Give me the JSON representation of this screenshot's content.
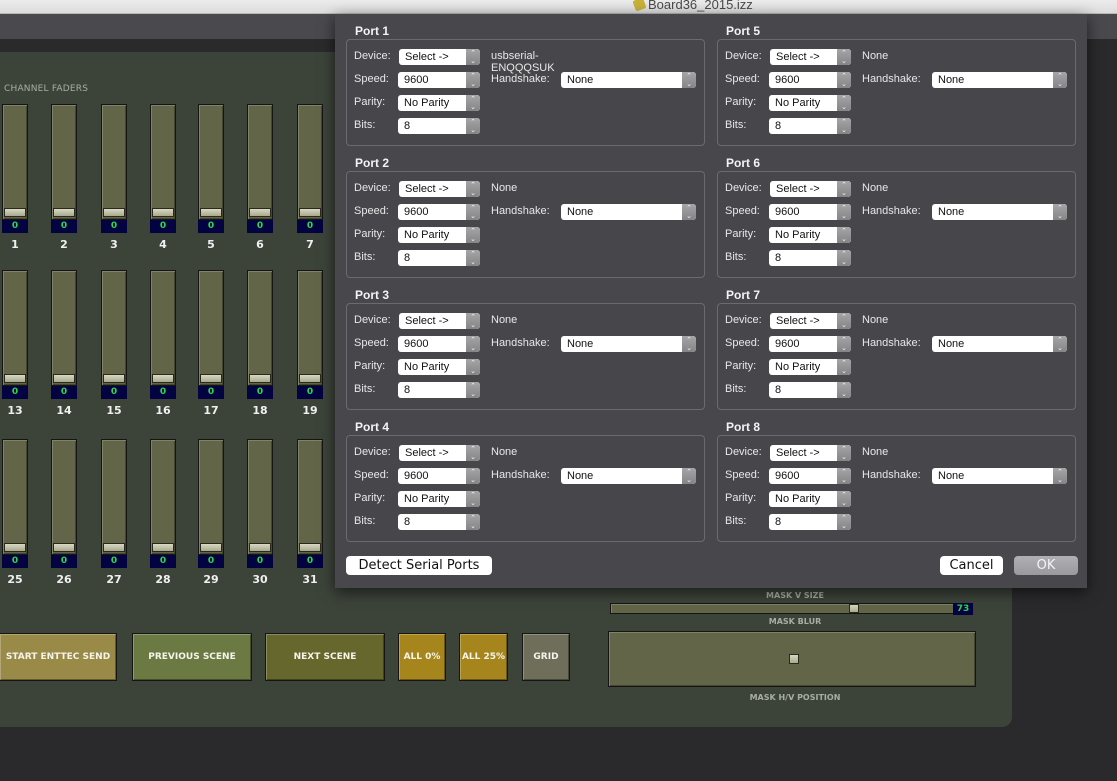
{
  "window": {
    "title": "Board36_2015.izz"
  },
  "board": {
    "section_label": "CHANNEL FADERS",
    "fader_rows": [
      {
        "channels": [
          {
            "num": "1",
            "value": "0"
          },
          {
            "num": "2",
            "value": "0"
          },
          {
            "num": "3",
            "value": "0"
          },
          {
            "num": "4",
            "value": "0"
          },
          {
            "num": "5",
            "value": "0"
          },
          {
            "num": "6",
            "value": "0"
          },
          {
            "num": "7",
            "value": "0"
          }
        ]
      },
      {
        "channels": [
          {
            "num": "13",
            "value": "0"
          },
          {
            "num": "14",
            "value": "0"
          },
          {
            "num": "15",
            "value": "0"
          },
          {
            "num": "16",
            "value": "0"
          },
          {
            "num": "17",
            "value": "0"
          },
          {
            "num": "18",
            "value": "0"
          },
          {
            "num": "19",
            "value": "0"
          }
        ]
      },
      {
        "channels": [
          {
            "num": "25",
            "value": "0"
          },
          {
            "num": "26",
            "value": "0"
          },
          {
            "num": "27",
            "value": "0"
          },
          {
            "num": "28",
            "value": "0"
          },
          {
            "num": "29",
            "value": "0"
          },
          {
            "num": "30",
            "value": "0"
          },
          {
            "num": "31",
            "value": "0"
          }
        ]
      }
    ],
    "buttons": [
      {
        "label": "START ENTTEC SEND",
        "color": "#9a8a48"
      },
      {
        "label": "PREVIOUS SCENE",
        "color": "#6a7a42"
      },
      {
        "label": "NEXT SCENE",
        "color": "#66672c"
      },
      {
        "label": "ALL 0%",
        "color": "#a6861c"
      },
      {
        "label": "ALL 25%",
        "color": "#a6861c"
      },
      {
        "label": "GRID",
        "color": "#6e6e5a"
      }
    ],
    "mask": {
      "v_size_label": "MASK V SIZE",
      "blur_label": "MASK BLUR",
      "blur_value": "73",
      "hv_position_label": "MASK H/V POSITION"
    }
  },
  "dialog": {
    "labels": {
      "device": "Device:",
      "speed": "Speed:",
      "parity": "Parity:",
      "bits": "Bits:",
      "handshake": "Handshake:"
    },
    "ports": [
      {
        "title": "Port 1",
        "device_select": "Select ->",
        "device_name": "usbserial-ENQQQSUK",
        "speed": "9600",
        "handshake": "None",
        "parity": "No Parity",
        "bits": "8"
      },
      {
        "title": "Port 2",
        "device_select": "Select ->",
        "device_name": "None",
        "speed": "9600",
        "handshake": "None",
        "parity": "No Parity",
        "bits": "8"
      },
      {
        "title": "Port 3",
        "device_select": "Select ->",
        "device_name": "None",
        "speed": "9600",
        "handshake": "None",
        "parity": "No Parity",
        "bits": "8"
      },
      {
        "title": "Port 4",
        "device_select": "Select ->",
        "device_name": "None",
        "speed": "9600",
        "handshake": "None",
        "parity": "No Parity",
        "bits": "8"
      },
      {
        "title": "Port 5",
        "device_select": "Select ->",
        "device_name": "None",
        "speed": "9600",
        "handshake": "None",
        "parity": "No Parity",
        "bits": "8"
      },
      {
        "title": "Port 6",
        "device_select": "Select ->",
        "device_name": "None",
        "speed": "9600",
        "handshake": "None",
        "parity": "No Parity",
        "bits": "8"
      },
      {
        "title": "Port 7",
        "device_select": "Select ->",
        "device_name": "None",
        "speed": "9600",
        "handshake": "None",
        "parity": "No Parity",
        "bits": "8"
      },
      {
        "title": "Port 8",
        "device_select": "Select ->",
        "device_name": "None",
        "speed": "9600",
        "handshake": "None",
        "parity": "No Parity",
        "bits": "8"
      }
    ],
    "detect_button": "Detect Serial Ports",
    "cancel_button": "Cancel",
    "ok_button": "OK"
  }
}
